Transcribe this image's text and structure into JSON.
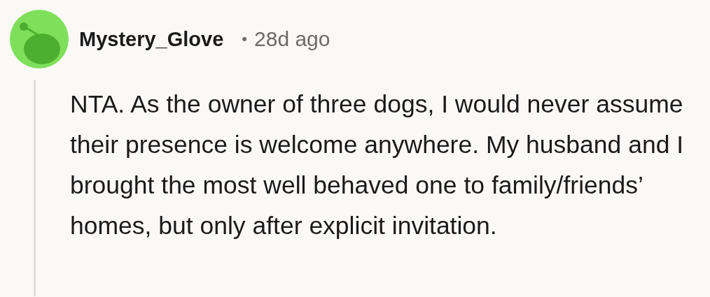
{
  "comment": {
    "author": "Mystery_Glove",
    "separator": "•",
    "age": "28d ago",
    "body": "NTA. As the owner of three dogs, I would never assume their presence is welcome anywhere. My husband and I brought the most well behaved one to family/friends’ homes, but only after explicit invitation."
  }
}
